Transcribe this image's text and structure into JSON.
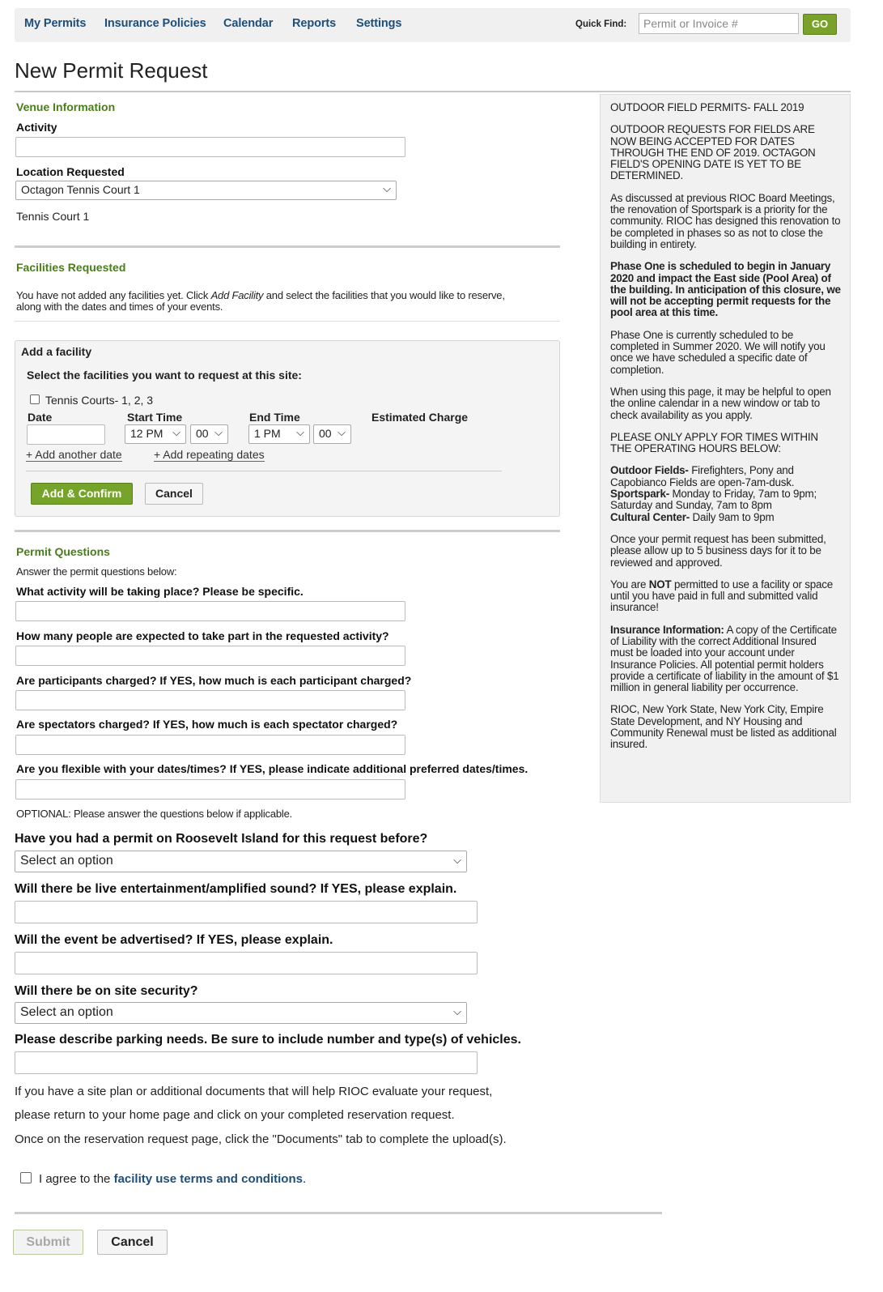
{
  "nav": {
    "items": [
      "My Permits",
      "Insurance Policies",
      "Calendar",
      "Reports",
      "Settings"
    ],
    "quick_find_label": "Quick Find:",
    "quick_find_placeholder": "Permit or Invoice #",
    "go_label": "GO"
  },
  "page_title": "New Permit Request",
  "venue": {
    "section": "Venue Information",
    "activity_label": "Activity",
    "location_label": "Location Requested",
    "location_value": "Octagon Tennis Court 1",
    "location_desc": "Tennis Court 1"
  },
  "facilities": {
    "section": "Facilities Requested",
    "note_pre": "You have not added any facilities yet. Click ",
    "note_em": "Add Facility",
    "note_post": " and select the facilities that you would like to reserve,",
    "note_line2": "along with the dates and times of your events."
  },
  "add_facility": {
    "title": "Add a facility",
    "subtitle": "Select the facilities you want to request at this site:",
    "facility_name": "Tennis Courts- 1, 2, 3",
    "date_label": "Date",
    "start_label": "Start Time",
    "end_label": "End Time",
    "charge_label": "Estimated Charge",
    "start_hour": "12 PM",
    "start_min": "00",
    "end_hour": "1 PM",
    "end_min": "00",
    "add_date": "+ Add another date",
    "add_repeating": "+ Add repeating dates",
    "confirm": "Add & Confirm",
    "cancel": "Cancel"
  },
  "questions": {
    "section": "Permit Questions",
    "intro": "Answer the permit questions below:",
    "q1": "What activity will be taking place? Please be specific.",
    "q2": "How many people are expected to take part in the requested activity?",
    "q3": "Are participants charged? If YES, how much is each participant charged?",
    "q4": "Are spectators charged? If YES, how much is each spectator charged?",
    "q5": "Are you flexible with your dates/times? If YES, please indicate additional preferred dates/times.",
    "optional": "OPTIONAL: Please answer the questions below if applicable.",
    "q6": "Have you had a permit on Roosevelt Island for this request before?",
    "q6_value": "Select an option",
    "q7": "Will there be live entertainment/amplified sound? If YES, please explain.",
    "q8": "Will the event be advertised? If YES, please explain.",
    "q9": "Will there be on site security?",
    "q9_value": "Select an option",
    "q10": "Please describe parking needs. Be sure to include number and type(s) of vehicles."
  },
  "docs_note": {
    "line1": "If you have a site plan or additional documents that will help RIOC evaluate your request,",
    "line2": "please return to your home page and click on your completed reservation request.",
    "line3": "Once on the reservation request page, click the \"Documents\" tab to complete the upload(s)."
  },
  "terms": {
    "pre": "I agree to the ",
    "link": "facility use terms and conditions",
    "post": "."
  },
  "footer": {
    "submit": "Submit",
    "cancel": "Cancel"
  },
  "sidebar": {
    "p1": "OUTDOOR FIELD PERMITS- FALL 2019",
    "p2": "OUTDOOR REQUESTS FOR FIELDS ARE NOW BEING ACCEPTED FOR DATES THROUGH THE END OF 2019. OCTAGON FIELD'S OPENING DATE IS YET TO BE DETERMINED.",
    "p3": "As discussed at previous RIOC Board Meetings, the renovation of Sportspark is a priority for the community. RIOC has designed this renovation to be completed in phases so as not to close the building in entirety.",
    "p4": "Phase One is scheduled to begin in January 2020 and impact the East side (Pool Area) of the building. In anticipation of this closure, we will not be accepting permit requests for the pool area at this time.",
    "p5": "Phase One is currently scheduled to be completed in Summer 2020. We will notify you once we have scheduled a specific date of completion.",
    "p6": "When using this page, it may be helpful to open the online calendar in a new window or tab to check availability as you apply.",
    "p7": "PLEASE ONLY APPLY FOR TIMES WITHIN THE OPERATING HOURS BELOW:",
    "p8_b1": "Outdoor Fields-",
    "p8_t1": " Firefighters, Pony and Capobianco Fields are open-7am-dusk.",
    "p8_b2": "Sportspark-",
    "p8_t2": " Monday to Friday, 7am to 9pm; Saturday and Sunday, 7am to 8pm",
    "p8_b3": "Cultural Center-",
    "p8_t3": " Daily 9am to 9pm",
    "p9": "Once your permit request has been submitted, please allow up to 5 business days for it to be reviewed and approved.",
    "p10_pre": "You are ",
    "p10_b": "NOT",
    "p10_post": " permitted to use a facility or space until you have paid in full and submitted valid insurance!",
    "p11_b": "Insurance Information:",
    "p11_t": " A copy of the Certificate of Liability with the correct Additional Insured must be loaded into your account under Insurance Policies. All potential permit holders provide a certificate of liability in the amount of $1 million in general liability per occurrence.",
    "p12": "RIOC, New York State, New York City, Empire State Development, and NY Housing and Community Renewal must be listed as additional insured."
  }
}
